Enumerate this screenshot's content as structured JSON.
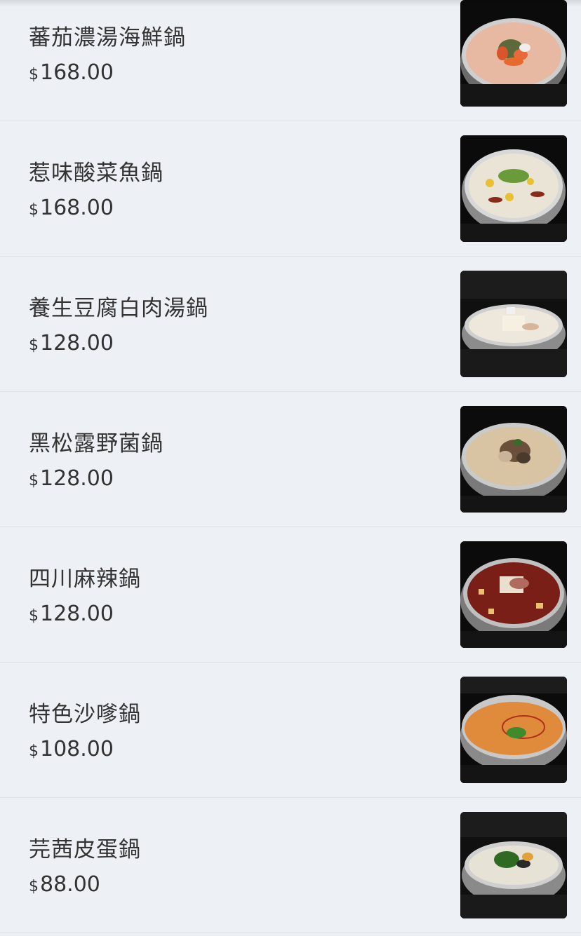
{
  "menu": {
    "items": [
      {
        "name": "蕃茄濃湯海鮮鍋",
        "currency": "$",
        "amount": "168.00",
        "image_icon": "tomato-seafood-hotpot-image",
        "broth_color": "#e8b9a2"
      },
      {
        "name": "惹味酸菜魚鍋",
        "currency": "$",
        "amount": "168.00",
        "image_icon": "pickled-fish-hotpot-image",
        "broth_color": "#e9e4d6"
      },
      {
        "name": "養生豆腐白肉湯鍋",
        "currency": "$",
        "amount": "128.00",
        "image_icon": "tofu-pork-hotpot-image",
        "broth_color": "#ede7dc"
      },
      {
        "name": "黑松露野菌鍋",
        "currency": "$",
        "amount": "128.00",
        "image_icon": "truffle-mushroom-hotpot-image",
        "broth_color": "#d8c3a3"
      },
      {
        "name": "四川麻辣鍋",
        "currency": "$",
        "amount": "128.00",
        "image_icon": "sichuan-spicy-hotpot-image",
        "broth_color": "#7a1f17"
      },
      {
        "name": "特色沙嗲鍋",
        "currency": "$",
        "amount": "108.00",
        "image_icon": "satay-hotpot-image",
        "broth_color": "#e08a3c"
      },
      {
        "name": "芫茜皮蛋鍋",
        "currency": "$",
        "amount": "88.00",
        "image_icon": "coriander-century-egg-hotpot-image",
        "broth_color": "#e7e2d6"
      }
    ]
  }
}
